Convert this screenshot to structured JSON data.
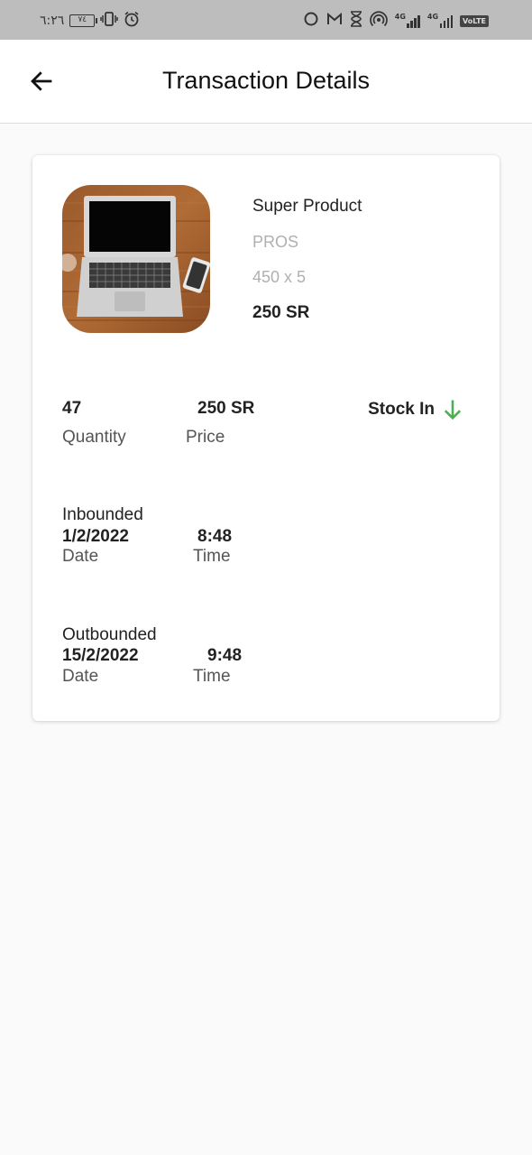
{
  "status_bar": {
    "time": "٦:٢٦",
    "battery": "٧٤",
    "network_4g_label": "4G",
    "volte_label": "VoLTE"
  },
  "header": {
    "title": "Transaction Details",
    "back_icon": "arrow-left-icon"
  },
  "product": {
    "name": "Super Product",
    "category": "PROS",
    "dimensions": "450 x 5",
    "price": "250 SR",
    "image_icon": "laptop-image"
  },
  "summary": {
    "quantity_value": "47",
    "quantity_label": "Quantity",
    "price_value": "250 SR",
    "price_label": "Price",
    "stock_status": "Stock In",
    "stock_icon": "arrow-down-icon",
    "stock_color": "#4caf50"
  },
  "inbound": {
    "heading": "Inbounded",
    "date_value": "1/2/2022",
    "date_label": "Date",
    "time_value": "8:48",
    "time_label": "Time"
  },
  "outbound": {
    "heading": "Outbounded",
    "date_value": "15/2/2022",
    "date_label": "Date",
    "time_value": "9:48",
    "time_label": "Time"
  }
}
